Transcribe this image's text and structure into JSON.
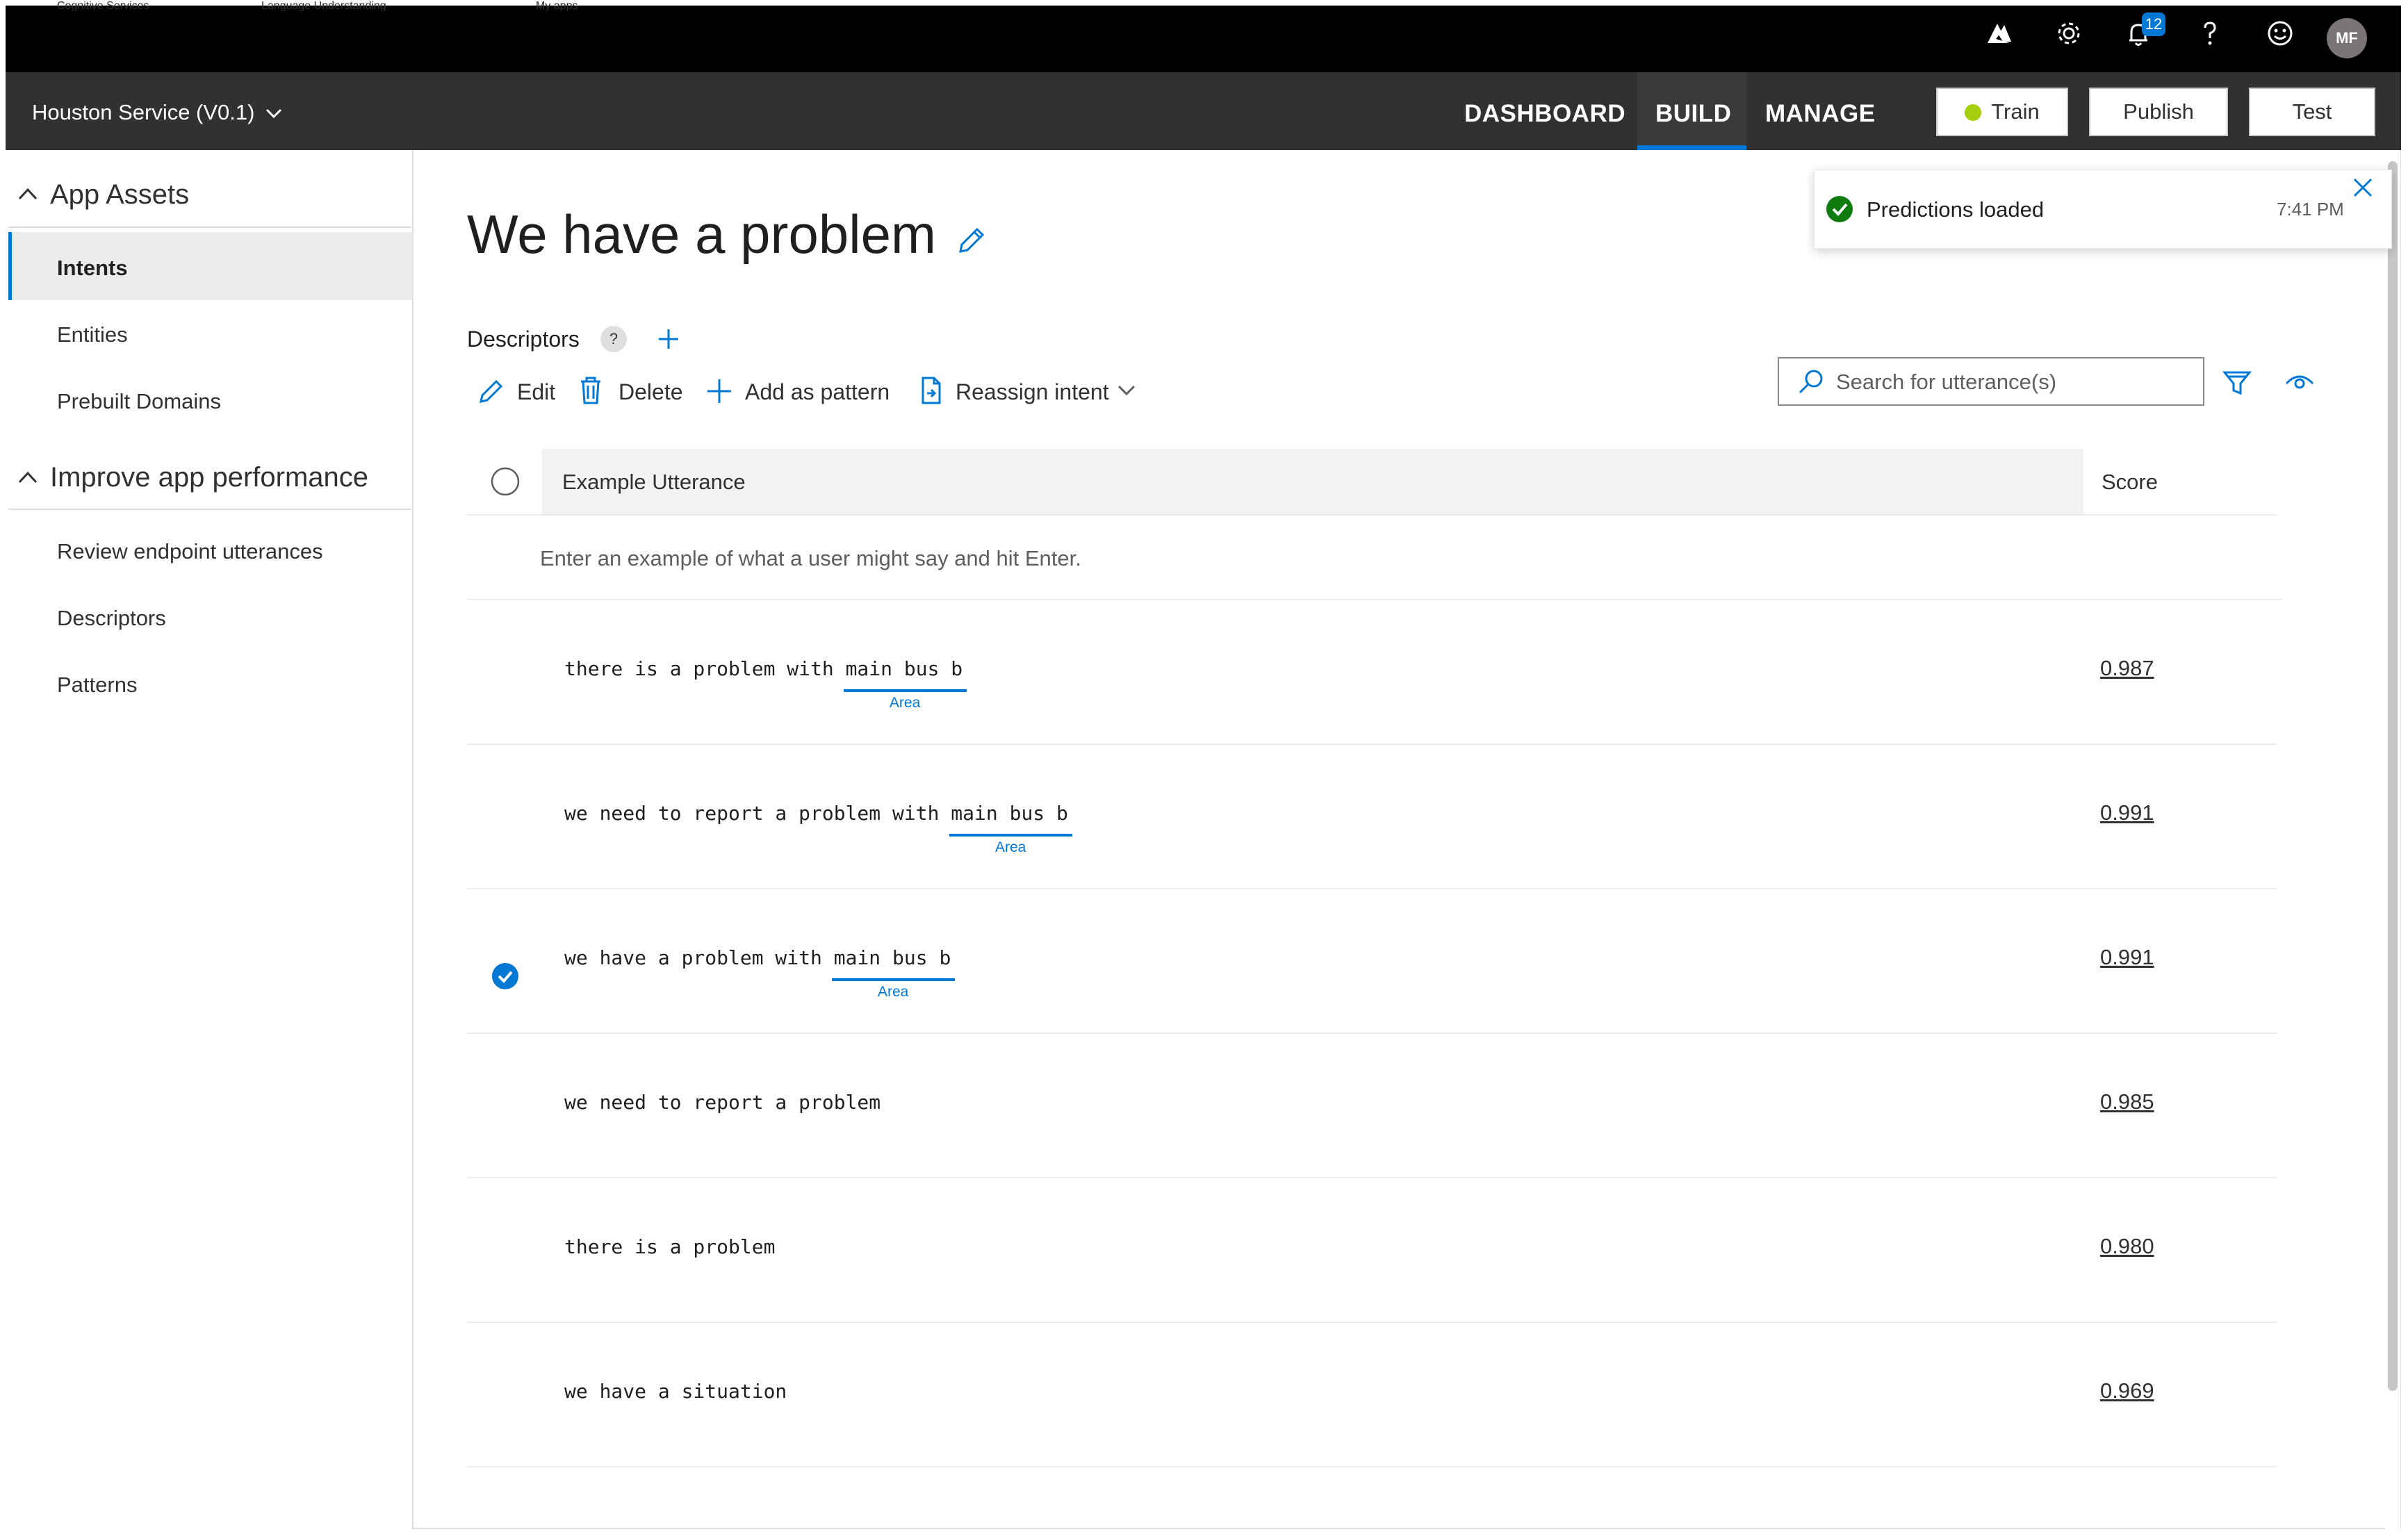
{
  "topbar": {
    "links": [
      "Cognitive Services",
      "Language Understanding",
      "My apps"
    ],
    "notification_count": "12",
    "avatar_initials": "MF",
    "icons": [
      "azure-icon",
      "gear-icon",
      "bell-icon",
      "help-icon",
      "smiley-icon"
    ]
  },
  "appbar": {
    "app_name": "Houston Service (V0.1)",
    "tabs": [
      "DASHBOARD",
      "BUILD",
      "MANAGE"
    ],
    "active_tab": "BUILD",
    "train_label": "Train",
    "publish_label": "Publish",
    "test_label": "Test"
  },
  "sidebar": {
    "section1": "App Assets",
    "section1_items": [
      "Intents",
      "Entities",
      "Prebuilt Domains"
    ],
    "selected_item": "Intents",
    "section2": "Improve app performance",
    "section2_items": [
      "Review endpoint utterances",
      "Descriptors",
      "Patterns"
    ]
  },
  "intent": {
    "title": "We have a problem",
    "descriptors_label": "Descriptors",
    "help_glyph": "?"
  },
  "toolbar": {
    "edit": "Edit",
    "delete": "Delete",
    "add_pattern": "Add as pattern",
    "reassign": "Reassign intent"
  },
  "search": {
    "placeholder": "Search for utterance(s)"
  },
  "table": {
    "col_utterance": "Example Utterance",
    "col_score": "Score",
    "input_hint": "Enter an example of what a user might say and hit Enter.",
    "rows": [
      {
        "pre": "there is a problem with ",
        "entity": "main bus b",
        "entity_label": "Area",
        "score": "0.987",
        "selected": false
      },
      {
        "pre": "we need to report a problem with ",
        "entity": "main bus b",
        "entity_label": "Area",
        "score": "0.991",
        "selected": false
      },
      {
        "pre": "we have a problem with ",
        "entity": "main bus b",
        "entity_label": "Area",
        "score": "0.991",
        "selected": true
      },
      {
        "pre": "we need to report a problem",
        "entity": "",
        "entity_label": "",
        "score": "0.985",
        "selected": false
      },
      {
        "pre": "there is a problem",
        "entity": "",
        "entity_label": "",
        "score": "0.980",
        "selected": false
      },
      {
        "pre": "we have a situation",
        "entity": "",
        "entity_label": "",
        "score": "0.969",
        "selected": false
      }
    ]
  },
  "toast": {
    "message": "Predictions loaded",
    "time": "7:41 PM"
  },
  "colors": {
    "accent": "#0078d4",
    "topbar": "#000000",
    "appbar": "#323130",
    "success": "#107c10",
    "train_dot": "#a4cf0c"
  }
}
